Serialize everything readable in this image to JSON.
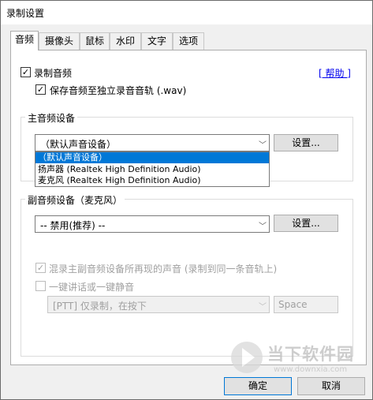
{
  "window": {
    "title": "录制设置"
  },
  "tabs": [
    {
      "label": "音频"
    },
    {
      "label": "摄像头"
    },
    {
      "label": "鼠标"
    },
    {
      "label": "水印"
    },
    {
      "label": "文字"
    },
    {
      "label": "选项"
    }
  ],
  "record_audio": {
    "label": "录制音频",
    "checked": true
  },
  "help_link": "[ 帮助 ]",
  "save_separate": {
    "label": "保存音频至独立录音音轨 (.wav)",
    "checked": true
  },
  "main_device": {
    "group_label": "主音频设备",
    "selected": "（默认声音设备）",
    "settings_label": "设置...",
    "options": [
      "（默认声音设备）",
      "扬声器 (Realtek High Definition Audio)",
      "麦克风 (Realtek High Definition Audio)"
    ]
  },
  "secondary_device": {
    "group_label": "副音频设备（麦克风）",
    "selected": "-- 禁用(推荐) --",
    "settings_label": "设置..."
  },
  "mix_option": {
    "label": "混录主副音频设备所再现的声音 (录制到同一条音轨上)",
    "checked": true
  },
  "ptt_option": {
    "label": "一键讲话或一键静音",
    "checked": false
  },
  "ptt_mode": {
    "selected": "[PTT] 仅录制，在按下"
  },
  "ptt_key": {
    "value": "Space"
  },
  "buttons": {
    "ok": "确定",
    "cancel": "取消"
  },
  "watermark": {
    "brand": "当下软件园",
    "url": "www.downxia.com"
  },
  "colors": {
    "accent": "#0078d7",
    "link": "#0000ee",
    "disabled": "#a0a0a0"
  }
}
